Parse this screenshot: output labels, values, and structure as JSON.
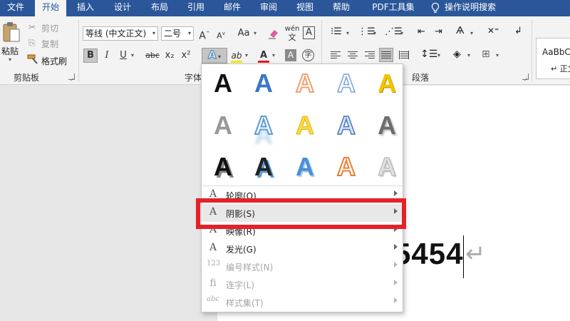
{
  "tabs": [
    {
      "label": "文件",
      "active": false
    },
    {
      "label": "开始",
      "active": true
    },
    {
      "label": "插入",
      "active": false
    },
    {
      "label": "设计",
      "active": false
    },
    {
      "label": "布局",
      "active": false
    },
    {
      "label": "引用",
      "active": false
    },
    {
      "label": "邮件",
      "active": false
    },
    {
      "label": "审阅",
      "active": false
    },
    {
      "label": "视图",
      "active": false
    },
    {
      "label": "帮助",
      "active": false
    },
    {
      "label": "PDF工具集",
      "active": false
    },
    {
      "label": "操作说明搜索",
      "active": false
    }
  ],
  "clipboard": {
    "paste": "粘贴",
    "cut": "剪切",
    "copy": "复制",
    "format_painter": "格式刷",
    "group_label": "剪贴板"
  },
  "font": {
    "font_name": "等线 (中文正文)",
    "font_size": "二号",
    "bold": "B",
    "italic": "I",
    "underline": "U",
    "strike": "abc",
    "subscript": "x₂",
    "superscript": "x²",
    "grow": "A",
    "shrink": "A",
    "change_case": "Aa",
    "pinyin": "wén",
    "border_char": "A",
    "group_label": "字体",
    "highlight_color": "#f5e800",
    "font_color": "#e31b23"
  },
  "paragraph": {
    "group_label": "段落"
  },
  "styles": {
    "sample": "AaBbC",
    "name": "↵ 正文"
  },
  "document": {
    "text": "5454"
  },
  "text_effects_menu": {
    "gallery_items": 15,
    "items": [
      {
        "label": "轮廓(O)",
        "icon": "outline-icon",
        "disabled": false
      },
      {
        "label": "阴影(S)",
        "icon": "shadow-icon",
        "disabled": false,
        "hover": true
      },
      {
        "label": "映像(R)",
        "icon": "reflection-icon",
        "disabled": false
      },
      {
        "label": "发光(G)",
        "icon": "glow-icon",
        "disabled": false
      },
      {
        "label": "编号样式(N)",
        "icon": "number-style-icon",
        "disabled": true
      },
      {
        "label": "连字(L)",
        "icon": "ligature-icon",
        "disabled": true
      },
      {
        "label": "样式集(T)",
        "icon": "stylistic-set-icon",
        "disabled": true
      }
    ]
  },
  "highlight_color": "#e52127"
}
